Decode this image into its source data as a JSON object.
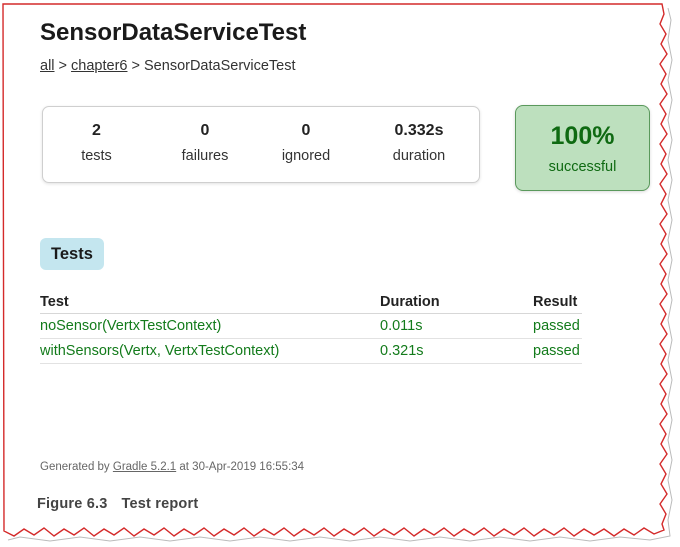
{
  "header": {
    "title": "SensorDataServiceTest"
  },
  "breadcrumb": {
    "items": [
      "all",
      "chapter6"
    ],
    "separator": ">",
    "current": "SensorDataServiceTest"
  },
  "summary": {
    "counters": [
      {
        "value": "2",
        "label": "tests"
      },
      {
        "value": "0",
        "label": "failures"
      },
      {
        "value": "0",
        "label": "ignored"
      },
      {
        "value": "0.332s",
        "label": "duration"
      }
    ],
    "success": {
      "value": "100%",
      "label": "successful"
    }
  },
  "tests_section": {
    "tab_label": "Tests",
    "columns": [
      "Test",
      "Duration",
      "Result"
    ],
    "rows": [
      [
        "noSensor(VertxTestContext)",
        "0.011s",
        "passed"
      ],
      [
        "withSensors(Vertx, VertxTestContext)",
        "0.321s",
        "passed"
      ]
    ]
  },
  "footer": {
    "prefix": "Generated by",
    "link": "Gradle 5.2.1",
    "suffix": "at 30-Apr-2019 16:55:34"
  },
  "caption": {
    "number": "Figure 6.3",
    "text": "Test report"
  },
  "colors": {
    "success_text": "#137b1b",
    "success_bg": "#bde0be",
    "tab_bg": "#c4e6ef",
    "frame": "#d42a2a"
  }
}
